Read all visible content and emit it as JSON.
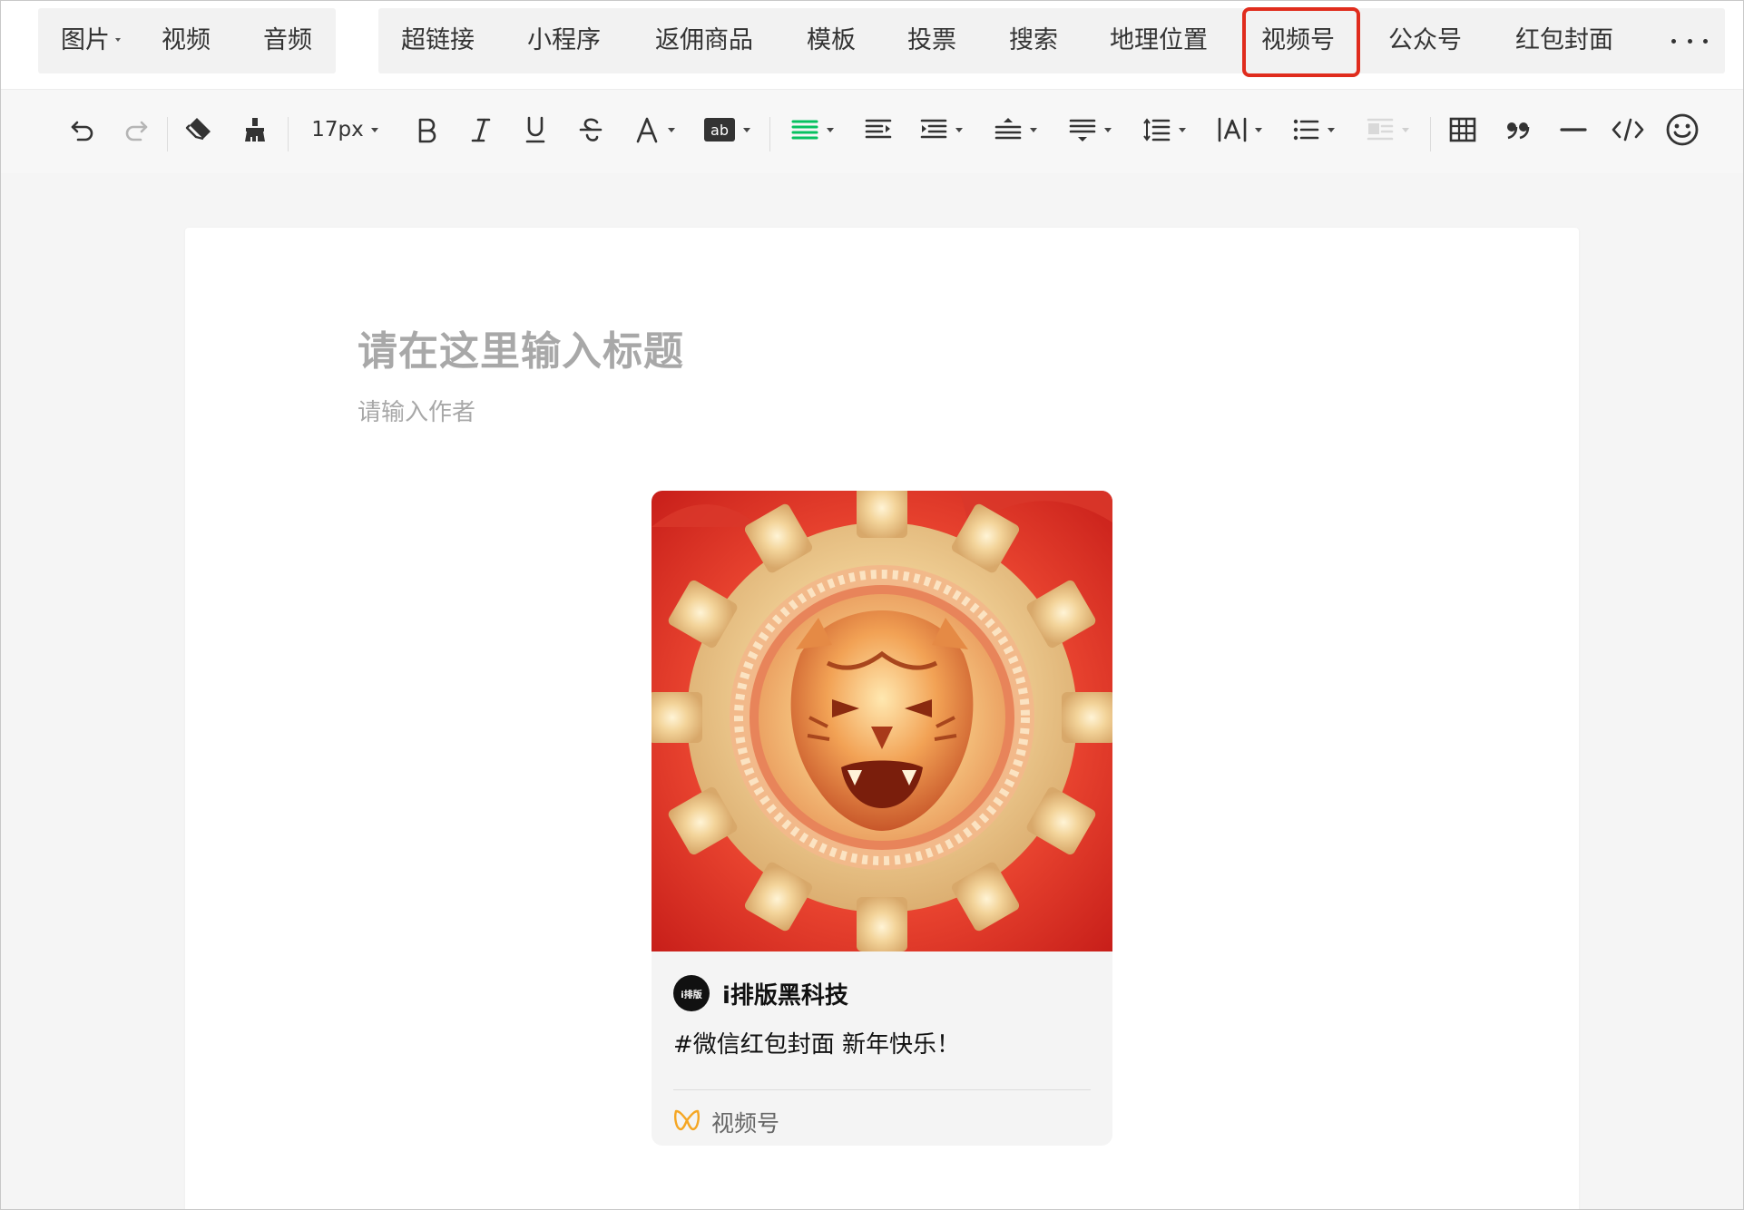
{
  "insert_bar": {
    "group1": [
      {
        "label": "图片",
        "has_dropdown": true
      },
      {
        "label": "视频"
      },
      {
        "label": "音频"
      }
    ],
    "group2": [
      {
        "label": "超链接"
      },
      {
        "label": "小程序"
      },
      {
        "label": "返佣商品"
      },
      {
        "label": "模板"
      },
      {
        "label": "投票"
      },
      {
        "label": "搜索"
      },
      {
        "label": "地理位置"
      },
      {
        "label": "视频号",
        "highlighted": true
      },
      {
        "label": "公众号"
      },
      {
        "label": "红包封面"
      }
    ],
    "more_icon": "more-horizontal-icon"
  },
  "toolbar": {
    "font_size": "17px",
    "icons": [
      "undo-icon",
      "redo-icon",
      "eraser-icon",
      "format-painter-icon",
      "bold-icon",
      "italic-icon",
      "underline-icon",
      "strikethrough-icon",
      "font-color-icon",
      "background-color-icon",
      "align-left-icon",
      "indent-icon",
      "align-center-icon",
      "paragraph-spacing-top-icon",
      "paragraph-spacing-bottom-icon",
      "line-height-icon",
      "letter-spacing-icon",
      "list-icon",
      "float-icon",
      "table-icon",
      "quote-icon",
      "divider-icon",
      "code-icon",
      "emoji-icon"
    ],
    "active_color": "#07c160"
  },
  "editor": {
    "title_placeholder": "请在这里输入标题",
    "author_placeholder": "请输入作者"
  },
  "channel_card": {
    "avatar_text": "i排版",
    "author": "i排版黑科技",
    "description": "#微信红包封面 新年快乐！",
    "source_label": "视频号",
    "source_icon": "channels-icon"
  },
  "colors": {
    "highlight": "#e02c1d",
    "accent_green": "#07c160",
    "channels_orange": "#f5a623"
  }
}
